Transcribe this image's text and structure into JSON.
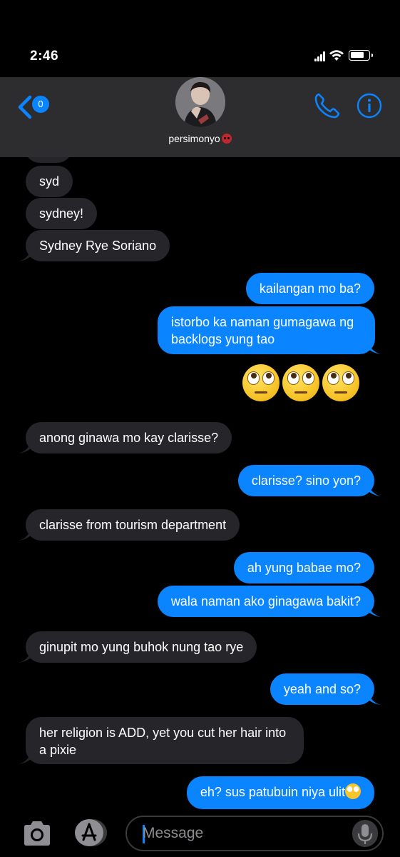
{
  "status_bar": {
    "time": "2:46"
  },
  "header": {
    "back_badge_count": "0",
    "contact_name": "persimonyo",
    "contact_emoji": "red-face-emoji"
  },
  "messages": [
    {
      "direction": "in",
      "text": "syd"
    },
    {
      "direction": "in",
      "text": "sydney!"
    },
    {
      "direction": "in",
      "text": "Sydney Rye Soriano"
    },
    {
      "direction": "out",
      "text": "kailangan mo ba?"
    },
    {
      "direction": "out",
      "text": "istorbo ka naman gumagawa ng backlogs yung tao"
    },
    {
      "direction": "out",
      "emoji": "face-with-rolling-eyes x3"
    },
    {
      "direction": "in",
      "text": "anong ginawa mo kay clarisse?"
    },
    {
      "direction": "out",
      "text": "clarisse? sino yon?"
    },
    {
      "direction": "in",
      "text": "clarisse from tourism department"
    },
    {
      "direction": "out",
      "text": "ah yung babae mo?"
    },
    {
      "direction": "out",
      "text": "wala naman ako ginagawa bakit?"
    },
    {
      "direction": "in",
      "text": "ginupit mo yung buhok nung tao rye"
    },
    {
      "direction": "out",
      "text": "yeah and so?"
    },
    {
      "direction": "in",
      "text": "her religion is ADD, yet you cut her hair into a pixie"
    },
    {
      "direction": "out",
      "text": "eh? sus patubuin niya ulit"
    }
  ],
  "input_bar": {
    "placeholder": "Message"
  },
  "colors": {
    "outgoing": "#0a84ff",
    "incoming": "#26252a",
    "header": "#2d2d2f",
    "accent": "#0b84ff"
  }
}
